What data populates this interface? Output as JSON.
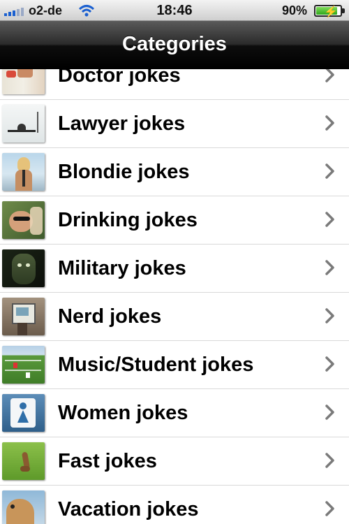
{
  "status": {
    "carrier": "o2-de",
    "time": "18:46",
    "battery_pct": "90%",
    "battery_level": 0.9
  },
  "nav": {
    "title": "Categories"
  },
  "categories": [
    {
      "label": "Doctor jokes",
      "thumb": "doctor-thumbnail"
    },
    {
      "label": "Lawyer jokes",
      "thumb": "lawyer-thumbnail"
    },
    {
      "label": "Blondie jokes",
      "thumb": "blondie-thumbnail"
    },
    {
      "label": "Drinking jokes",
      "thumb": "drinking-thumbnail"
    },
    {
      "label": "Military jokes",
      "thumb": "military-thumbnail"
    },
    {
      "label": "Nerd jokes",
      "thumb": "nerd-thumbnail"
    },
    {
      "label": "Music/Student jokes",
      "thumb": "music-student-thumbnail"
    },
    {
      "label": "Women jokes",
      "thumb": "women-thumbnail"
    },
    {
      "label": "Fast jokes",
      "thumb": "fast-thumbnail"
    },
    {
      "label": "Vacation jokes",
      "thumb": "vacation-thumbnail"
    }
  ],
  "icons": {
    "chevron": "chevron-right-icon"
  },
  "colors": {
    "signal": "#1a5fd0",
    "chevron": "#7a7a7a"
  }
}
